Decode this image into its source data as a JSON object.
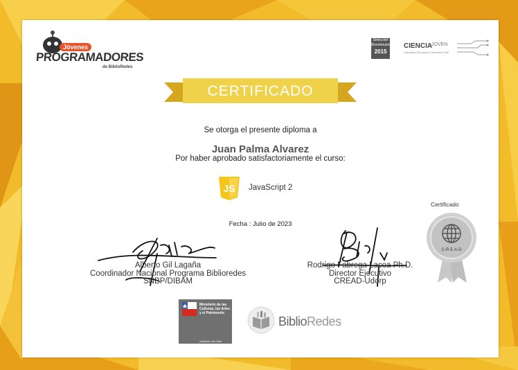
{
  "colors": {
    "background_gold": "#f2bb2a",
    "ribbon_yellow": "#f0d24a",
    "ribbon_dark": "#d4a71f",
    "js_yellow": "#f5c518",
    "text": "#222222"
  },
  "logos": {
    "left": {
      "badge": "Jóvenes",
      "wordmark": "PROGRAMADORES",
      "byline": "de BiblioRedes"
    },
    "right": {
      "box_line1": "Selección",
      "box_line2": "Bicentenario",
      "box_year": "2015",
      "brand": "CIENCIA",
      "brand2": "JOVEN",
      "subline": "Campaña Educación Científica Chile"
    },
    "biblioredes": {
      "part1": "Biblio",
      "part2": "Redes"
    },
    "gobierno": {
      "ministry": "Ministerio de las Culturas, las Artes y el Patrimonio",
      "footer": "Gobierno de Chile"
    }
  },
  "certificate": {
    "title": "CERTIFICADO",
    "line1": "Se otorga el presente diploma a",
    "recipient": "Juan Palma Alvarez",
    "line2": "Por haber aprobado satisfactoriamente el curso:",
    "course_icon_text": "JS",
    "course": "JavaScript 2",
    "date": "Fecha : Julio de 2023"
  },
  "signatories": [
    {
      "name": "Alberto Gil Lagaña",
      "role": "Coordinador Nacional Programa Biblioredes",
      "org": "SNBP/DIBAM"
    },
    {
      "name": "Rodrigo Fabrega Lacoa Ph.D.",
      "role": "Director Ejecutivo",
      "org": "CREAD-Udorp"
    }
  ],
  "seal": {
    "label": "Certificado",
    "text": "C·R·E·A·D"
  }
}
